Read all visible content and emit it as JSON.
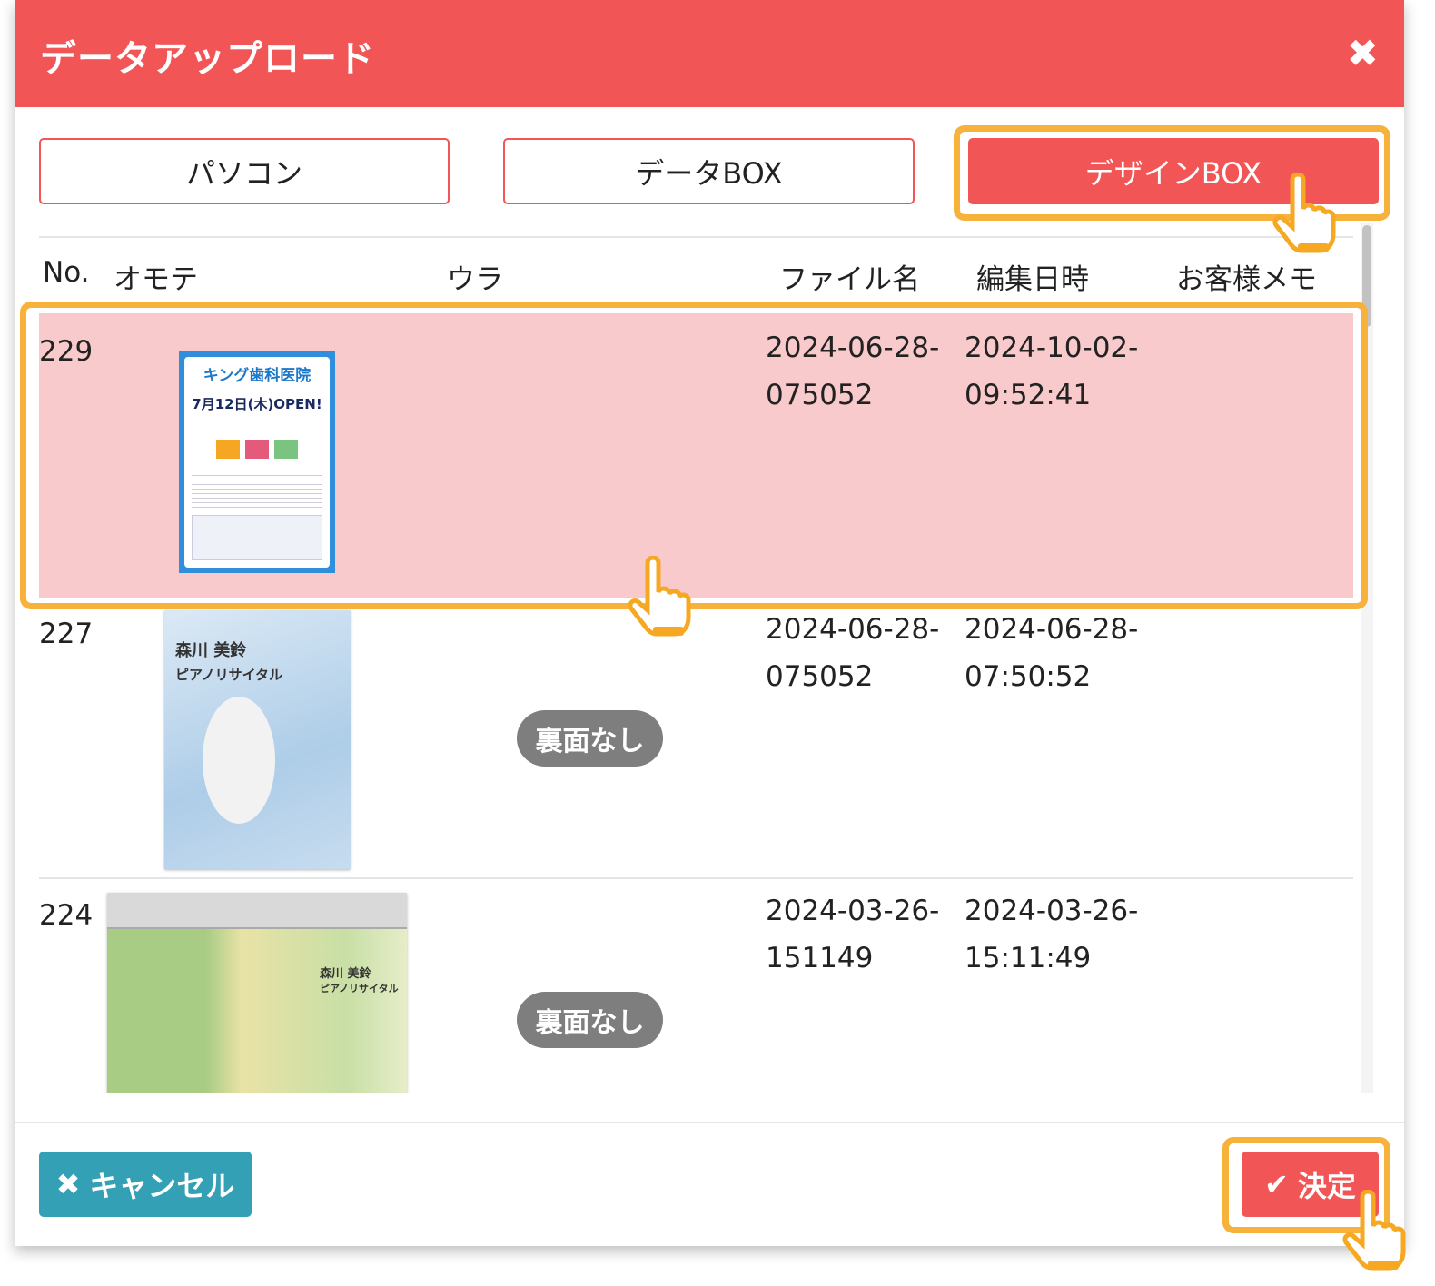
{
  "dialog": {
    "title": "データアップロード",
    "close_icon": "close-icon"
  },
  "sources": [
    {
      "label": "パソコン"
    },
    {
      "label": "データBOX"
    },
    {
      "label": "デザインBOX",
      "active": true
    }
  ],
  "columns": {
    "no": "No.",
    "front": "オモテ",
    "back": "ウラ",
    "filename": "ファイル名",
    "edited": "編集日時",
    "memo": "お客様メモ"
  },
  "rows": [
    {
      "no": "229",
      "filename_1": "2024-06-28-",
      "filename_2": "075052",
      "edited_1": "2024-10-02-",
      "edited_2": "09:52:41",
      "back": "",
      "selected": true,
      "thumb": {
        "title": "キング歯科医院",
        "date": "7月12日(木)OPEN!"
      }
    },
    {
      "no": "227",
      "filename_1": "2024-06-28-",
      "filename_2": "075052",
      "edited_1": "2024-06-28-",
      "edited_2": "07:50:52",
      "back": "裏面なし",
      "thumb": {
        "title": "森川 美鈴",
        "subtitle": "ピアノリサイタル"
      }
    },
    {
      "no": "224",
      "filename_1": "2024-03-26-",
      "filename_2": "151149",
      "edited_1": "2024-03-26-",
      "edited_2": "15:11:49",
      "back": "裏面なし",
      "thumb": {
        "title": "森川 美鈴",
        "subtitle": "ピアノリサイタル"
      }
    }
  ],
  "footer": {
    "cancel": "キャンセル",
    "confirm": "決定"
  },
  "colors": {
    "primary": "#f25556",
    "cancel": "#33a0b5",
    "highlight": "#f7b23b",
    "selected_row": "#f8cacb"
  }
}
